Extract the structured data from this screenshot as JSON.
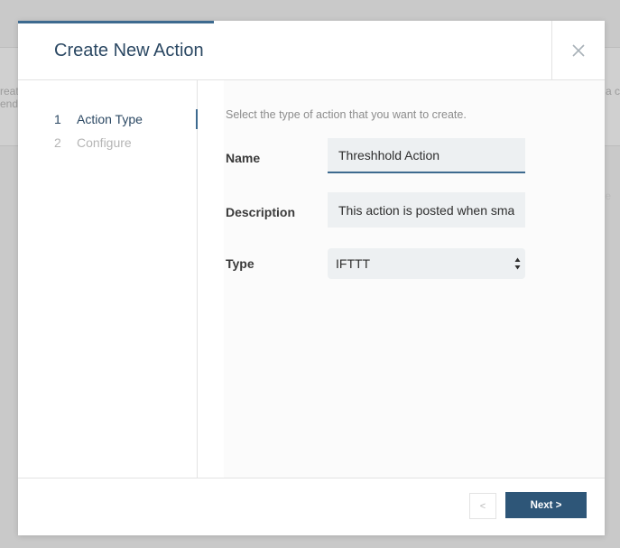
{
  "background": {
    "left_text": "reat\nend",
    "right_text": "a c",
    "dot_text": "e"
  },
  "modal": {
    "title": "Create New Action",
    "close_icon": "close-icon"
  },
  "steps": [
    {
      "number": "1",
      "label": "Action Type",
      "active": true
    },
    {
      "number": "2",
      "label": "Configure",
      "active": false
    }
  ],
  "form": {
    "instruction": "Select the type of action that you want to create.",
    "name": {
      "label": "Name",
      "value": "Threshhold Action"
    },
    "description": {
      "label": "Description",
      "value": "This action is posted when smart"
    },
    "type": {
      "label": "Type",
      "selected": "IFTTT"
    }
  },
  "footer": {
    "prev_label": "<",
    "next_label": "Next >"
  },
  "colors": {
    "accent": "#3d6a8f",
    "title": "#2b4863",
    "primary_button": "#2e5678"
  }
}
